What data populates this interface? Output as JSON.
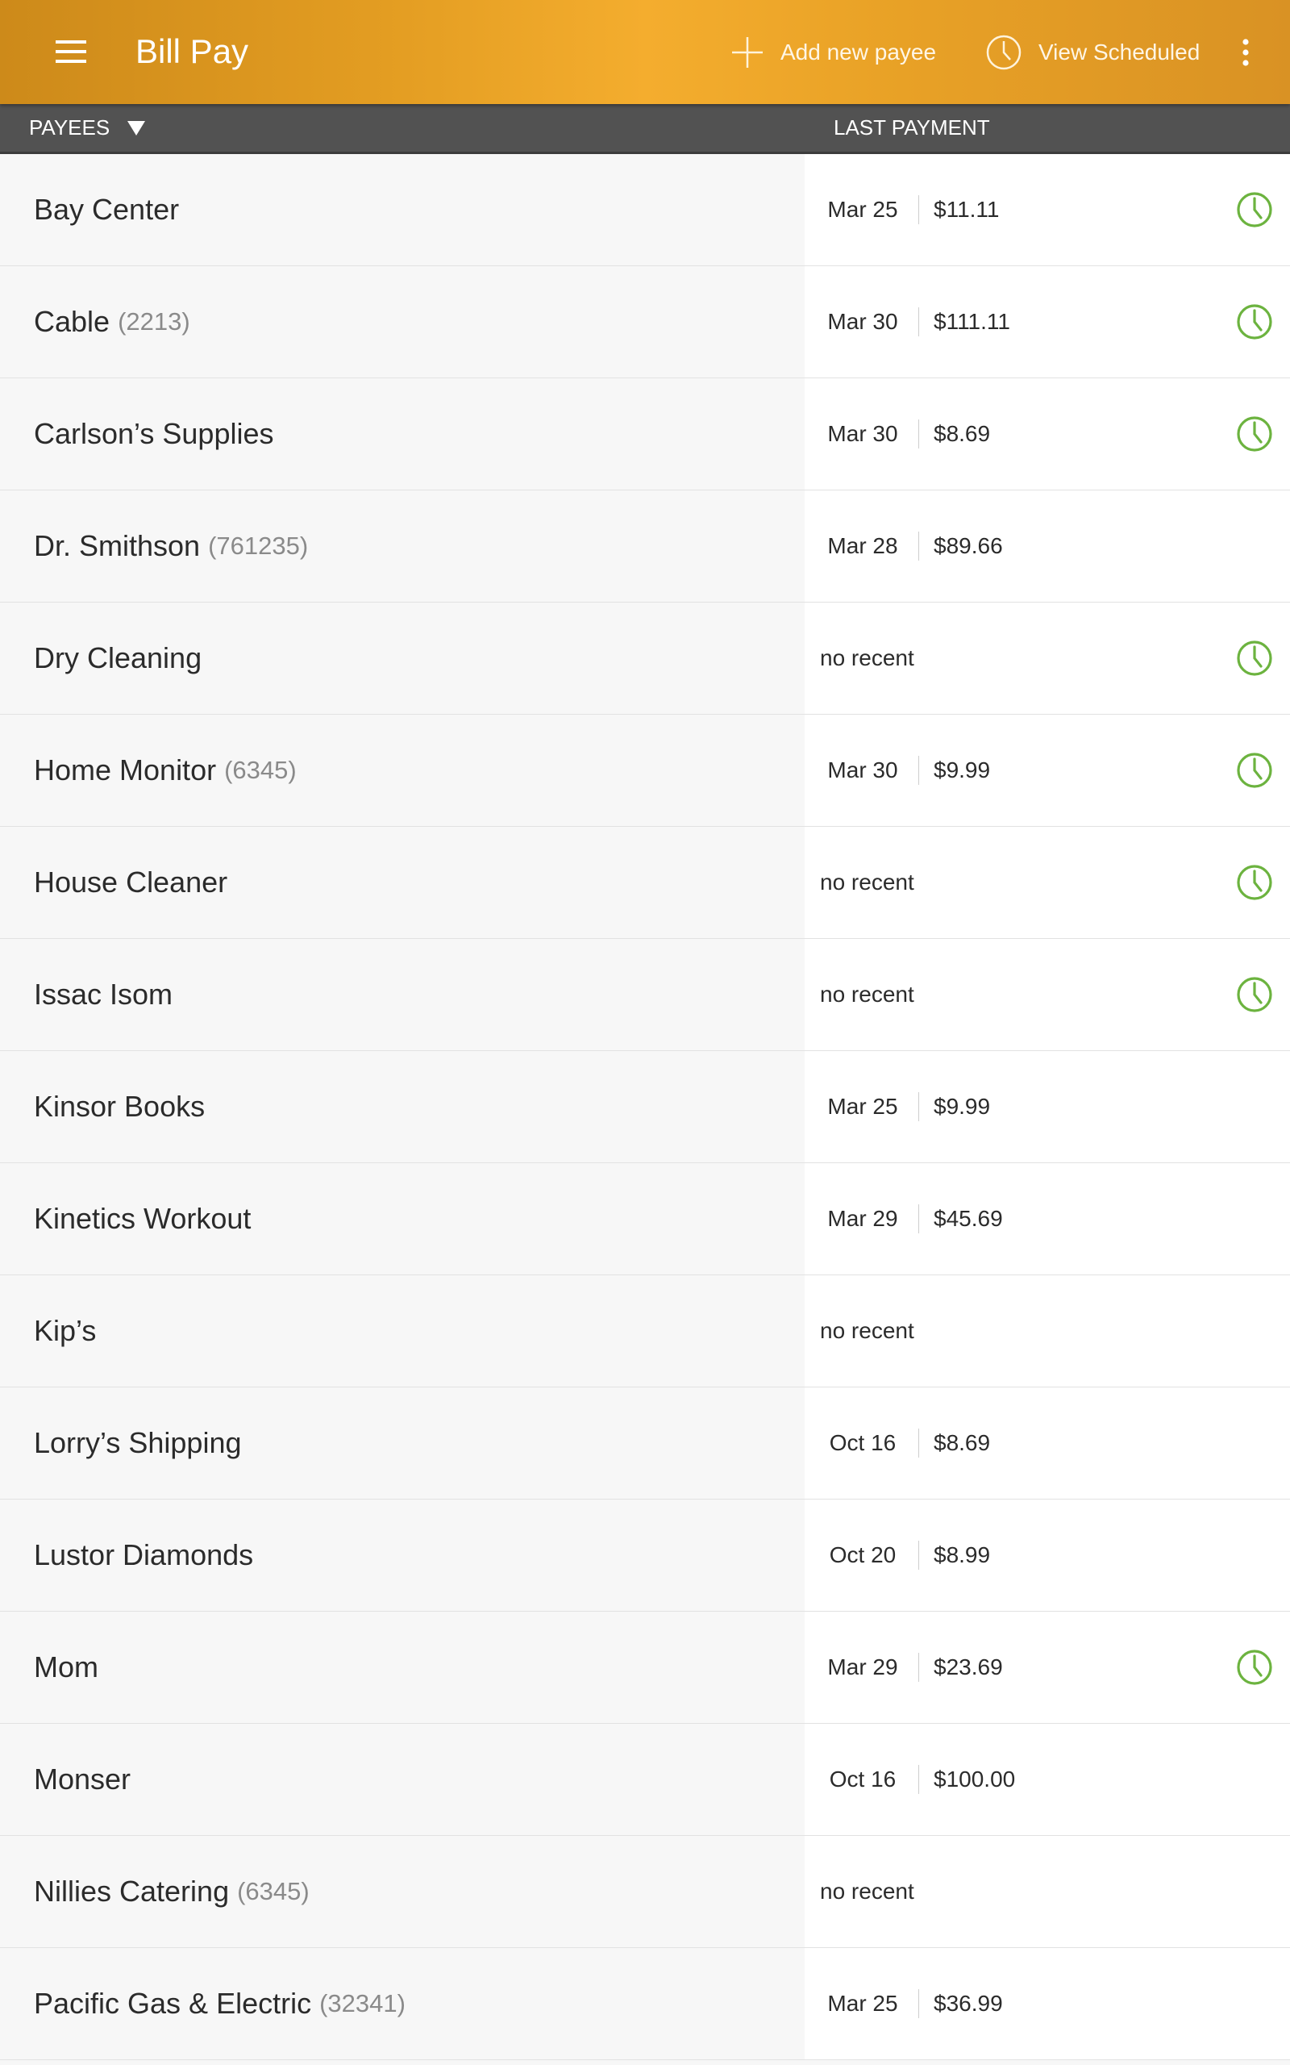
{
  "appbar": {
    "title": "Bill Pay",
    "actions": {
      "add_payee": "Add new payee",
      "view_scheduled": "View Scheduled"
    },
    "icons": {
      "menu": "hamburger-menu-icon",
      "add": "plus-icon",
      "scheduled": "clock-icon",
      "overflow": "vertical-dots-icon"
    }
  },
  "header": {
    "payees": "PAYEES",
    "last_payment": "LAST PAYMENT"
  },
  "colors": {
    "appbar_gradient": [
      "#cd8a1a",
      "#f4ad2e",
      "#d99224"
    ],
    "header_bg": "#525252",
    "scheduled_icon": "#6cb33f",
    "text": "#2b2b2b",
    "account_text": "#8a8a8a"
  },
  "payees": [
    {
      "name": "Bay Center",
      "account": "",
      "date": "Mar 25",
      "amount": "$11.11",
      "recent": "",
      "scheduled": true
    },
    {
      "name": "Cable",
      "account": "(2213)",
      "date": "Mar 30",
      "amount": "$111.11",
      "recent": "",
      "scheduled": true
    },
    {
      "name": "Carlson’s Supplies",
      "account": "",
      "date": "Mar 30",
      "amount": "$8.69",
      "recent": "",
      "scheduled": true
    },
    {
      "name": "Dr. Smithson",
      "account": "(761235)",
      "date": "Mar 28",
      "amount": "$89.66",
      "recent": "",
      "scheduled": false
    },
    {
      "name": "Dry Cleaning",
      "account": "",
      "date": "",
      "amount": "",
      "recent": "no recent",
      "scheduled": true
    },
    {
      "name": "Home Monitor",
      "account": "(6345)",
      "date": "Mar 30",
      "amount": "$9.99",
      "recent": "",
      "scheduled": true
    },
    {
      "name": "House Cleaner",
      "account": "",
      "date": "",
      "amount": "",
      "recent": "no recent",
      "scheduled": true
    },
    {
      "name": "Issac Isom",
      "account": "",
      "date": "",
      "amount": "",
      "recent": "no recent",
      "scheduled": true
    },
    {
      "name": "Kinsor Books",
      "account": "",
      "date": "Mar 25",
      "amount": "$9.99",
      "recent": "",
      "scheduled": false
    },
    {
      "name": "Kinetics Workout",
      "account": "",
      "date": "Mar 29",
      "amount": "$45.69",
      "recent": "",
      "scheduled": false
    },
    {
      "name": "Kip’s",
      "account": "",
      "date": "",
      "amount": "",
      "recent": "no recent",
      "scheduled": false
    },
    {
      "name": "Lorry’s Shipping",
      "account": "",
      "date": "Oct 16",
      "amount": "$8.69",
      "recent": "",
      "scheduled": false
    },
    {
      "name": "Lustor Diamonds",
      "account": "",
      "date": "Oct 20",
      "amount": "$8.99",
      "recent": "",
      "scheduled": false
    },
    {
      "name": "Mom",
      "account": "",
      "date": "Mar 29",
      "amount": "$23.69",
      "recent": "",
      "scheduled": true
    },
    {
      "name": "Monser",
      "account": "",
      "date": "Oct 16",
      "amount": "$100.00",
      "recent": "",
      "scheduled": false
    },
    {
      "name": "Nillies Catering",
      "account": "(6345)",
      "date": "",
      "amount": "",
      "recent": "no recent",
      "scheduled": false
    },
    {
      "name": "Pacific Gas & Electric",
      "account": "(32341)",
      "date": "Mar 25",
      "amount": "$36.99",
      "recent": "",
      "scheduled": false
    }
  ]
}
